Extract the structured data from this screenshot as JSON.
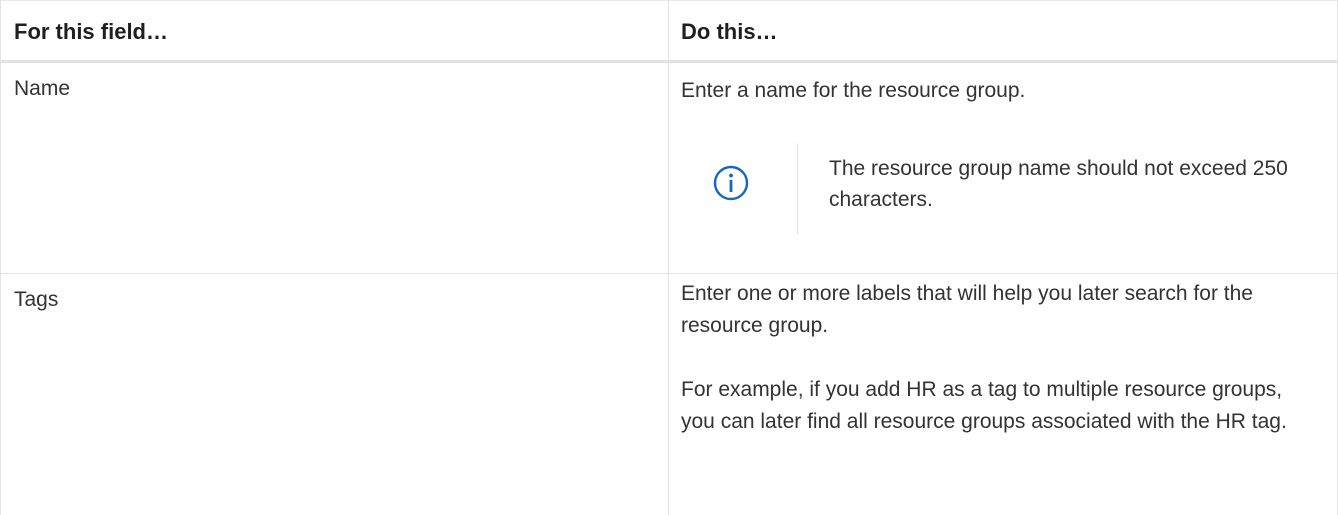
{
  "table": {
    "headers": {
      "field": "For this field…",
      "action": "Do this…"
    },
    "rows": [
      {
        "field": "Name",
        "paragraphs": [
          "Enter a name for the resource group."
        ],
        "note": {
          "icon": "info-icon",
          "text": "The resource group name should not exceed 250 characters."
        }
      },
      {
        "field": "Tags",
        "paragraphs": [
          "Enter one or more labels that will help you later search for the resource group.",
          "For example, if you add HR as a tag to multiple resource groups, you can later find all resource groups associated with the HR tag."
        ]
      }
    ]
  },
  "colors": {
    "info_icon": "#1566c0",
    "border": "#e3e3e3"
  }
}
